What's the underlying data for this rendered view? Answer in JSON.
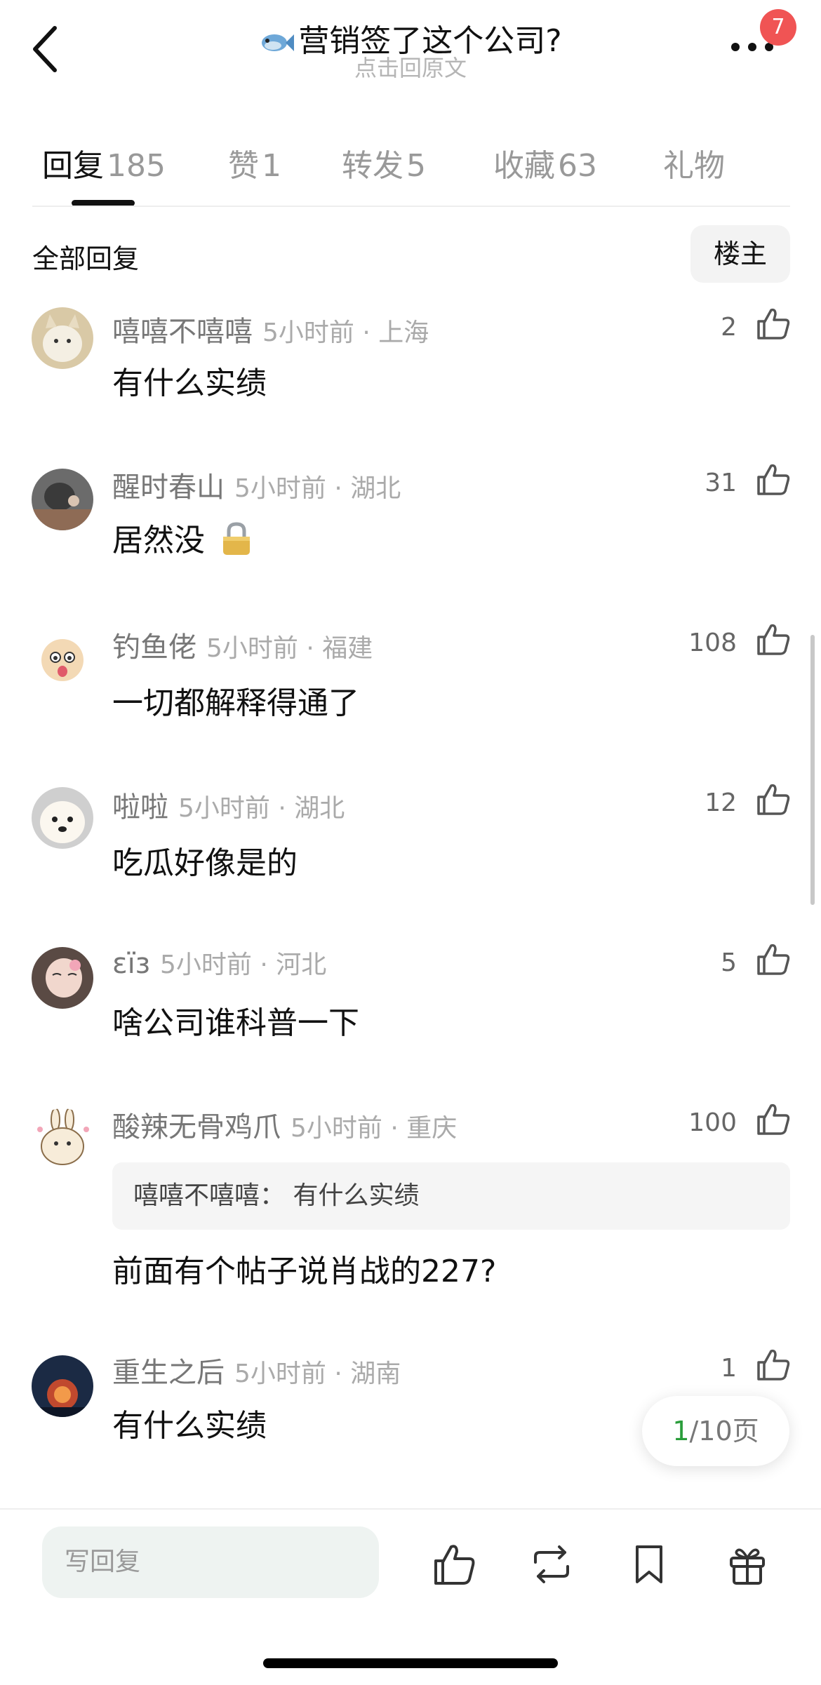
{
  "header": {
    "title": "营销签了这个公司?",
    "subtitle": "点击回原文",
    "notification_count": "7"
  },
  "tabs": [
    {
      "label": "回复",
      "count": "185"
    },
    {
      "label": "赞",
      "count": "1"
    },
    {
      "label": "转发",
      "count": "5"
    },
    {
      "label": "收藏",
      "count": "63"
    },
    {
      "label": "礼物",
      "count": ""
    }
  ],
  "section": {
    "title": "全部回复",
    "filter_button": "楼主"
  },
  "comments": [
    {
      "username": "嘻嘻不嘻嘻",
      "time_location": "5小时前 · 上海",
      "likes": "2",
      "text": "有什么实绩"
    },
    {
      "username": "醒时春山",
      "time_location": "5小时前 · 湖北",
      "likes": "31",
      "text": "居然没",
      "emoji": "lock"
    },
    {
      "username": "钓鱼佬",
      "time_location": "5小时前 · 福建",
      "likes": "108",
      "text": "一切都解释得通了"
    },
    {
      "username": "啦啦",
      "time_location": "5小时前 · 湖北",
      "likes": "12",
      "text": "吃瓜好像是的"
    },
    {
      "username": "εїз",
      "time_location": "5小时前 · 河北",
      "likes": "5",
      "text": "啥公司谁科普一下"
    },
    {
      "username": "酸辣无骨鸡爪",
      "time_location": "5小时前 · 重庆",
      "likes": "100",
      "quote": "嘻嘻不嘻嘻：  有什么实绩",
      "text": "前面有个帖子说肖战的227?"
    },
    {
      "username": "重生之后",
      "time_location": "5小时前 · 湖南",
      "likes": "1",
      "text": "有什么实绩"
    }
  ],
  "pagination": {
    "current": "1",
    "total": "/10页"
  },
  "bottom_bar": {
    "reply_placeholder": "写回复",
    "icons": [
      "thumbs-up-icon",
      "repost-icon",
      "bookmark-icon",
      "gift-icon"
    ]
  },
  "colors": {
    "badge": "#f05454",
    "page_current": "#2a9d3b",
    "reply_input_bg": "#eef3f1"
  }
}
